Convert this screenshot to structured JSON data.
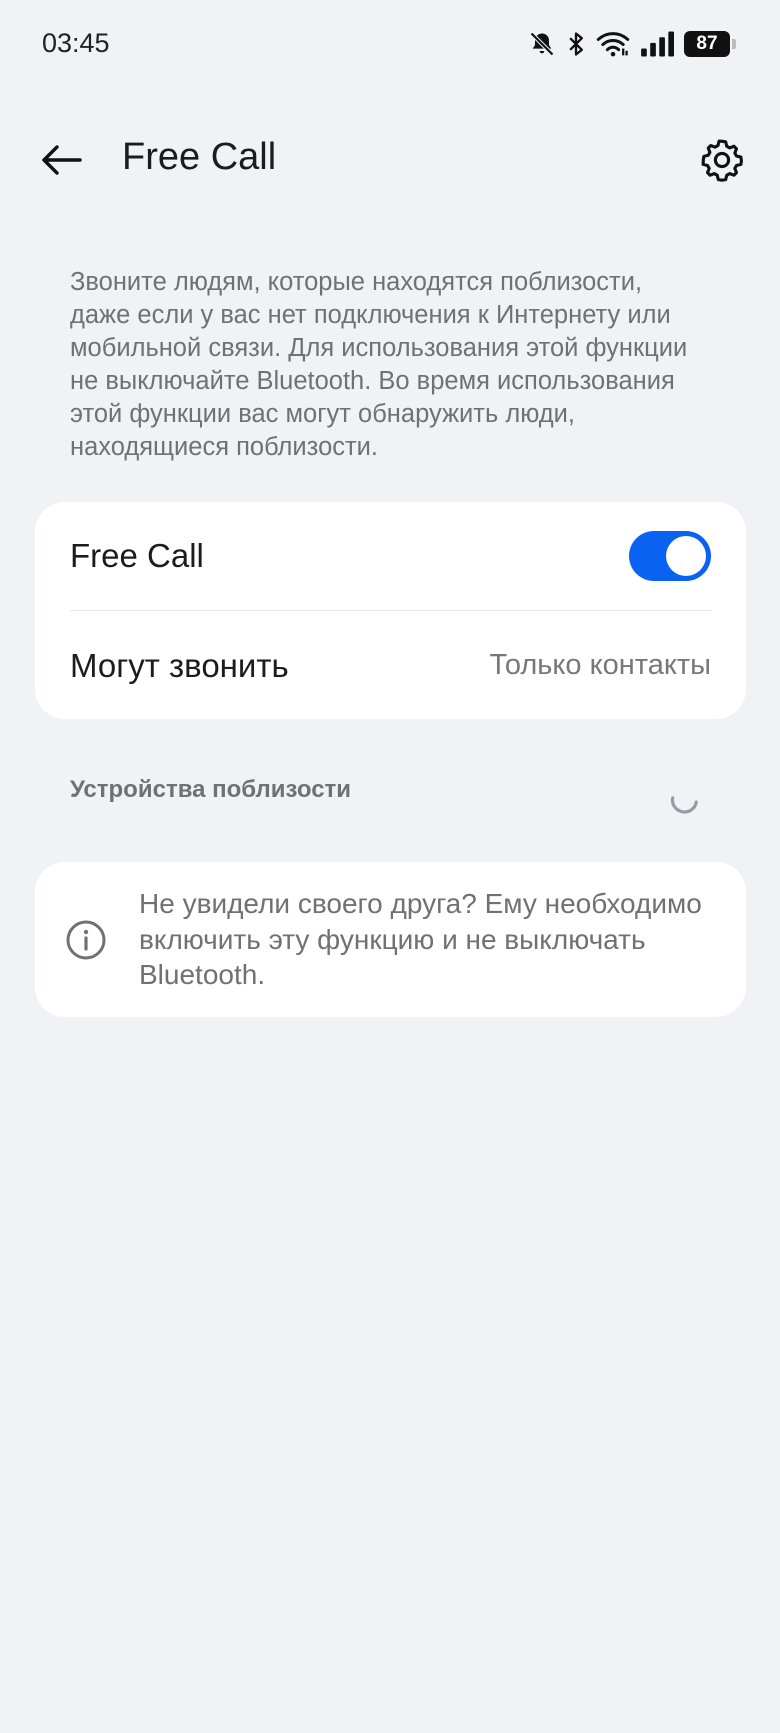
{
  "status_bar": {
    "time": "03:45",
    "icons": [
      "bell-off-icon",
      "bluetooth-icon",
      "wifi-icon",
      "signal-icon"
    ],
    "battery": "87"
  },
  "header": {
    "title": "Free Call",
    "back_icon": "arrow-left-icon",
    "settings_icon": "gear-icon"
  },
  "description": "Звоните людям, которые находятся поблизости, даже если у вас нет подключения к Интернету или мобильной связи. Для использования этой функции не выключайте Bluetooth. Во время использования этой функции вас могут обнаружить люди, находящиеся поблизости.",
  "settings": {
    "free_call_label": "Free Call",
    "free_call_enabled": true,
    "who_can_call_label": "Могут звонить",
    "who_can_call_value": "Только контакты"
  },
  "nearby": {
    "section_title": "Устройства поблизости"
  },
  "info": {
    "icon": "info-icon",
    "text": "Не увидели своего друга? Ему необходимо включить эту функцию и не выключать Bluetooth."
  },
  "colors": {
    "background": "#f1f2f5",
    "card": "#ffffff",
    "accent": "#0a62f2",
    "secondary_text": "#707075"
  }
}
